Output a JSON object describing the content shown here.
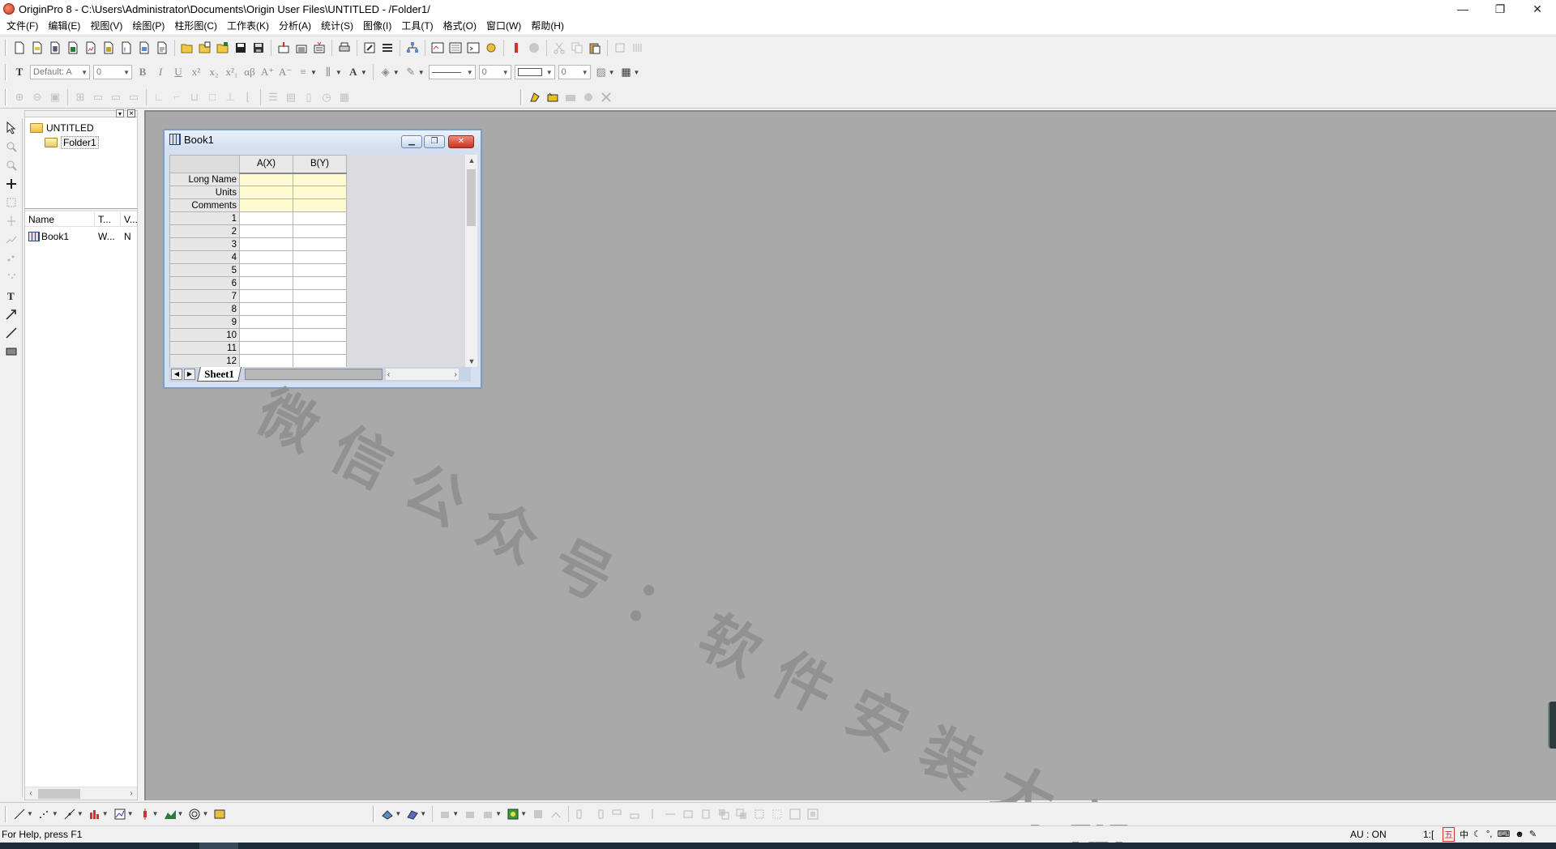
{
  "window": {
    "title": "OriginPro 8 - C:\\Users\\Administrator\\Documents\\Origin User Files\\UNTITLED - /Folder1/",
    "controls": {
      "minimize": "—",
      "maximize": "❐",
      "close": "✕"
    }
  },
  "menu": [
    "文件(F)",
    "编辑(E)",
    "视图(V)",
    "绘图(P)",
    "柱形图(C)",
    "工作表(K)",
    "分析(A)",
    "统计(S)",
    "图像(I)",
    "工具(T)",
    "格式(O)",
    "窗口(W)",
    "帮助(H)"
  ],
  "format_toolbar": {
    "font": "Default: A",
    "font_size": "0",
    "line_width": "0",
    "border_width": "0"
  },
  "explorer": {
    "tree_root": "UNTITLED",
    "tree_folder": "Folder1",
    "columns": [
      "Name",
      "T...",
      "V..."
    ],
    "rows": [
      {
        "name": "Book1",
        "type": "W...",
        "view": "N"
      }
    ]
  },
  "book": {
    "title": "Book1",
    "columns": [
      "A(X)",
      "B(Y)"
    ],
    "meta_rows": [
      "Long Name",
      "Units",
      "Comments"
    ],
    "row_numbers": [
      "1",
      "2",
      "3",
      "4",
      "5",
      "6",
      "7",
      "8",
      "9",
      "10",
      "11",
      "12"
    ],
    "sheet_tab": "Sheet1"
  },
  "watermark": "微信公众号：软件安装大神",
  "status": {
    "help": "For Help, press F1",
    "au": "AU : ON",
    "ratio": "1:["
  },
  "colors": {
    "workspace": "#a9a9a9",
    "meta_cell": "#fffbd0",
    "book_frame": "#7a9cc8"
  }
}
